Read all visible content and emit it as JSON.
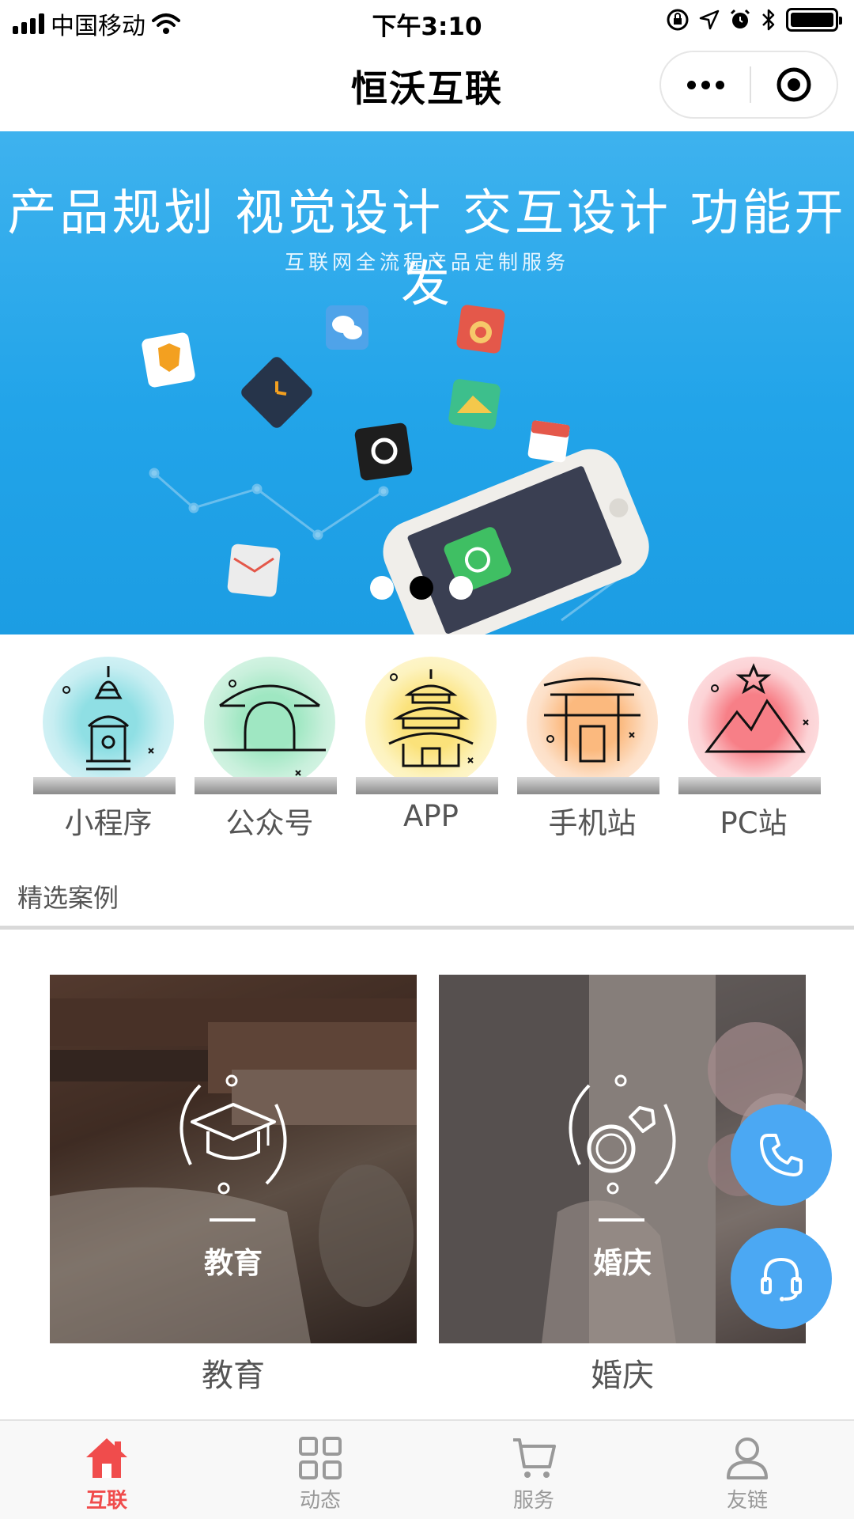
{
  "status_bar": {
    "carrier": "中国移动",
    "time": "下午3:10",
    "icons": [
      "signal-icon",
      "wifi-icon",
      "rotation-lock-icon",
      "location-icon",
      "alarm-icon",
      "bluetooth-icon",
      "battery-icon"
    ]
  },
  "nav": {
    "title": "恒沃互联",
    "more_icon": "more-dots-icon",
    "close_icon": "target-icon"
  },
  "banner": {
    "title": "产品规划 视觉设计 交互设计 功能开发",
    "subtitle": "互联网全流程产品定制服务",
    "slide_count": 3,
    "active_slide": 1
  },
  "categories": [
    {
      "label": "小程序",
      "icon": "pagoda-icon",
      "color": "#c8eef2"
    },
    {
      "label": "公众号",
      "icon": "arch-bridge-icon",
      "color": "#c9f0dc"
    },
    {
      "label": "APP",
      "icon": "temple-icon",
      "color": "#fdf3bf"
    },
    {
      "label": "手机站",
      "icon": "gate-icon",
      "color": "#fde0c8"
    },
    {
      "label": "PC站",
      "icon": "mountain-icon",
      "color": "#fcd3d6"
    }
  ],
  "section": {
    "title": "精选案例"
  },
  "cases": [
    {
      "overlay_label": "教育",
      "caption": "教育",
      "icon": "graduation-cap-icon"
    },
    {
      "overlay_label": "婚庆",
      "caption": "婚庆",
      "icon": "ring-icon"
    }
  ],
  "floating": {
    "phone_icon": "phone-icon",
    "service_icon": "headset-icon",
    "color": "#4ba8f3"
  },
  "tabs": [
    {
      "label": "互联",
      "icon": "home-icon",
      "active": true
    },
    {
      "label": "动态",
      "icon": "grid-icon",
      "active": false
    },
    {
      "label": "服务",
      "icon": "cart-icon",
      "active": false
    },
    {
      "label": "友链",
      "icon": "user-icon",
      "active": false
    }
  ],
  "colors": {
    "accent": "#f04c4c",
    "banner": "#22a4e9",
    "fab": "#4ba8f3"
  }
}
